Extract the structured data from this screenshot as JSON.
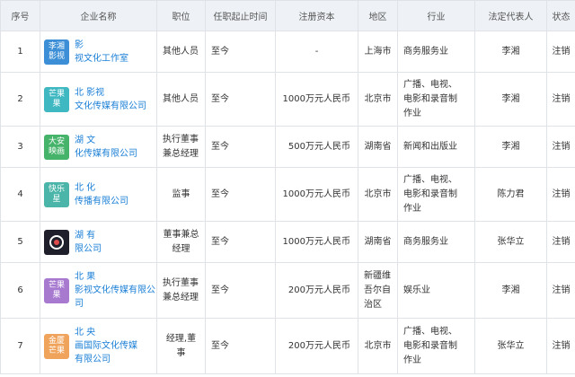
{
  "headers": [
    "序号",
    "企业名称",
    "职位",
    "任职起止时间",
    "注册资本",
    "地区",
    "行业",
    "法定代表人",
    "状态"
  ],
  "colors": {
    "link": "#1a7fd6",
    "status": "#e02a2a",
    "header_bg": "#eef2f6"
  },
  "rows": [
    {
      "index": "1",
      "logo_text": "李湘\n影视",
      "logo_color": "#3c8fd6",
      "company": "影\n视文化工作室",
      "position": "其他人员",
      "period": "至今",
      "capital": "-",
      "region": "上海市",
      "industry": "商务服务业",
      "legal_rep": "李湘",
      "status": "注销"
    },
    {
      "index": "2",
      "logo_text": "芒果\n果",
      "logo_color": "#3fb8c2",
      "company": "北 影视\n文化传媒有限公司",
      "position": "其他人员",
      "period": "至今",
      "capital": "1000万元人民币",
      "region": "北京市",
      "industry": "广播、电视、\n电影和录音制\n作业",
      "legal_rep": "李湘",
      "status": "注销"
    },
    {
      "index": "3",
      "logo_text": "大安\n映画",
      "logo_color": "#46b36b",
      "company": "湖 文\n化传媒有限公司",
      "position": "执行董事\n兼总经理",
      "period": "至今",
      "capital": "500万元人民币",
      "region": "湖南省",
      "industry": "新闻和出版业",
      "legal_rep": "李湘",
      "status": "注销"
    },
    {
      "index": "4",
      "logo_text": "快乐\n星",
      "logo_color": "#4ab5a8",
      "company": "北 化\n传播有限公司",
      "position": "监事",
      "period": "至今",
      "capital": "1000万元人民币",
      "region": "北京市",
      "industry": "广播、电视、\n电影和录音制\n作业",
      "legal_rep": "陈力君",
      "status": "注销"
    },
    {
      "index": "5",
      "logo_text": "",
      "logo_color": "#1f1f2c",
      "company": "湖 有\n限公司",
      "position": "董事兼总\n经理",
      "period": "至今",
      "capital": "1000万元人民币",
      "region": "湖南省",
      "industry": "商务服务业",
      "legal_rep": "张华立",
      "status": "注销"
    },
    {
      "index": "6",
      "logo_text": "芒果\n果",
      "logo_color": "#a77ad0",
      "company": "北 果\n影视文化传媒有限公司",
      "position": "执行董事\n兼总经理",
      "period": "至今",
      "capital": "200万元人民币",
      "region": "新疆维\n吾尔自\n治区",
      "industry": "娱乐业",
      "legal_rep": "李湘",
      "status": "注销"
    },
    {
      "index": "7",
      "logo_text": "金厦\n芒果",
      "logo_color": "#f0a35a",
      "company": "北 央\n画国际文化传媒\n有限公司",
      "position": "经理,董\n事",
      "period": "至今",
      "capital": "200万元人民币",
      "region": "北京市",
      "industry": "广播、电视、\n电影和录音制\n作业",
      "legal_rep": "张华立",
      "status": "注销"
    }
  ]
}
